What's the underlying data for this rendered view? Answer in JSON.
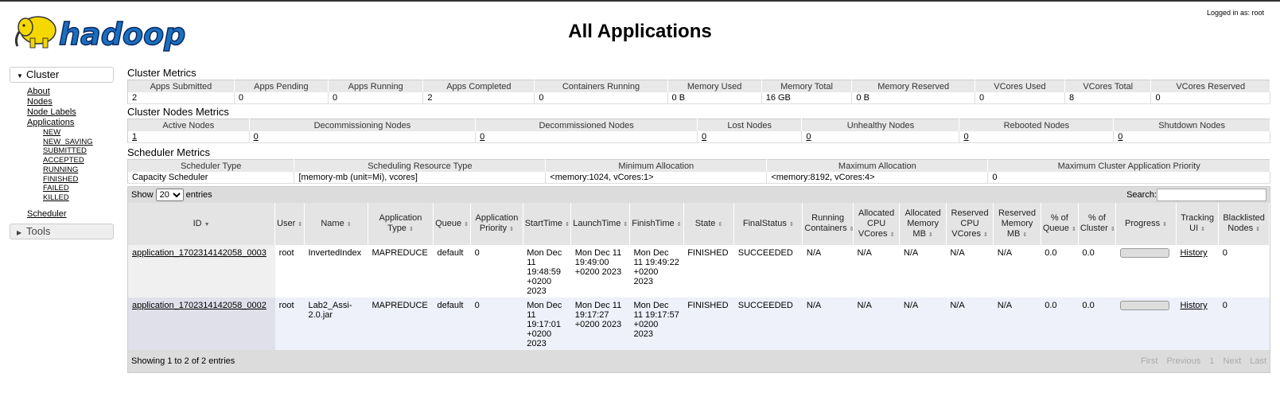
{
  "header": {
    "title": "All Applications",
    "logged_in": "Logged in as: root",
    "logo_text": "hadoop"
  },
  "sidebar": {
    "cluster_label": "Cluster",
    "links": [
      "About",
      "Nodes",
      "Node Labels",
      "Applications"
    ],
    "app_states": [
      "NEW",
      "NEW_SAVING",
      "SUBMITTED",
      "ACCEPTED",
      "RUNNING",
      "FINISHED",
      "FAILED",
      "KILLED"
    ],
    "scheduler": "Scheduler",
    "tools_label": "Tools"
  },
  "cluster_metrics": {
    "title": "Cluster Metrics",
    "headers": [
      "Apps Submitted",
      "Apps Pending",
      "Apps Running",
      "Apps Completed",
      "Containers Running",
      "Memory Used",
      "Memory Total",
      "Memory Reserved",
      "VCores Used",
      "VCores Total",
      "VCores Reserved"
    ],
    "values": [
      "2",
      "0",
      "0",
      "2",
      "0",
      "0 B",
      "16 GB",
      "0 B",
      "0",
      "8",
      "0"
    ]
  },
  "node_metrics": {
    "title": "Cluster Nodes Metrics",
    "headers": [
      "Active Nodes",
      "Decommissioning Nodes",
      "Decommissioned Nodes",
      "Lost Nodes",
      "Unhealthy Nodes",
      "Rebooted Nodes",
      "Shutdown Nodes"
    ],
    "values": [
      "1",
      "0",
      "0",
      "0",
      "0",
      "0",
      "0"
    ]
  },
  "scheduler_metrics": {
    "title": "Scheduler Metrics",
    "headers": [
      "Scheduler Type",
      "Scheduling Resource Type",
      "Minimum Allocation",
      "Maximum Allocation",
      "Maximum Cluster Application Priority"
    ],
    "values": [
      "Capacity Scheduler",
      "[memory-mb (unit=Mi), vcores]",
      "<memory:1024, vCores:1>",
      "<memory:8192, vCores:4>",
      "0"
    ]
  },
  "apps": {
    "show_label": "Show",
    "entries_value": "20",
    "entries_label": "entries",
    "search_label": "Search:",
    "columns": [
      "ID",
      "User",
      "Name",
      "Application Type",
      "Queue",
      "Application Priority",
      "StartTime",
      "LaunchTime",
      "FinishTime",
      "State",
      "FinalStatus",
      "Running Containers",
      "Allocated CPU VCores",
      "Allocated Memory MB",
      "Reserved CPU VCores",
      "Reserved Memory MB",
      "% of Queue",
      "% of Cluster",
      "Progress",
      "Tracking UI",
      "Blacklisted Nodes"
    ],
    "rows": [
      [
        "application_1702314142058_0003",
        "root",
        "InvertedIndex",
        "MAPREDUCE",
        "default",
        "0",
        "Mon Dec 11 19:48:59 +0200 2023",
        "Mon Dec 11 19:49:00 +0200 2023",
        "Mon Dec 11 19:49:22 +0200 2023",
        "FINISHED",
        "SUCCEEDED",
        "N/A",
        "N/A",
        "N/A",
        "N/A",
        "N/A",
        "0.0",
        "0.0",
        "",
        "History",
        "0"
      ],
      [
        "application_1702314142058_0002",
        "root",
        "Lab2_Assi-2.0.jar",
        "MAPREDUCE",
        "default",
        "0",
        "Mon Dec 11 19:17:01 +0200 2023",
        "Mon Dec 11 19:17:27 +0200 2023",
        "Mon Dec 11 19:17:57 +0200 2023",
        "FINISHED",
        "SUCCEEDED",
        "N/A",
        "N/A",
        "N/A",
        "N/A",
        "N/A",
        "0.0",
        "0.0",
        "",
        "History",
        "0"
      ]
    ],
    "footer_info": "Showing 1 to 2 of 2 entries",
    "pager": [
      "First",
      "Previous",
      "1",
      "Next",
      "Last"
    ]
  }
}
